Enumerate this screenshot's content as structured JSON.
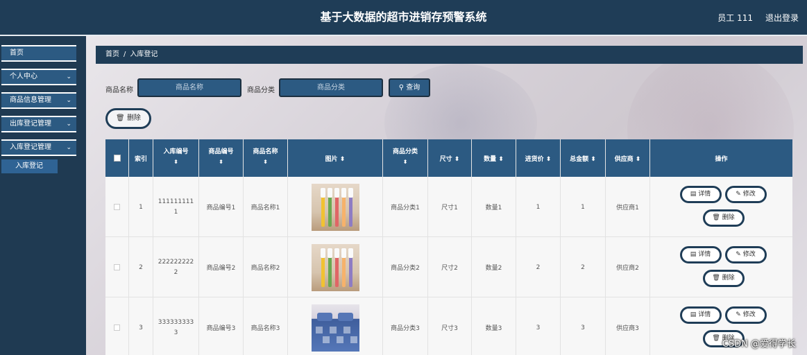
{
  "header": {
    "title": "基于大数据的超市进销存预警系统",
    "user": "员工 111",
    "logout": "退出登录"
  },
  "sidebar": {
    "items": [
      {
        "label": "首页",
        "chevron": ""
      },
      {
        "label": "个人中心",
        "chevron": "⌄"
      },
      {
        "label": "商品信息管理",
        "chevron": "⌄"
      },
      {
        "label": "出库登记管理",
        "chevron": "⌄"
      },
      {
        "label": "入库登记管理",
        "chevron": "⌄"
      }
    ],
    "sub_item": "入库登记"
  },
  "breadcrumb": {
    "home": "首页",
    "sep": "/",
    "current": "入库登记"
  },
  "search": {
    "name_label": "商品名称",
    "name_placeholder": "商品名称",
    "category_label": "商品分类",
    "category_placeholder": "商品分类",
    "query_button": "查询"
  },
  "delete_button": "删除",
  "table": {
    "headers": [
      "索引",
      "入库编号",
      "商品编号",
      "商品名称",
      "图片",
      "商品分类",
      "尺寸",
      "数量",
      "进货价",
      "总金额",
      "供应商",
      "操作"
    ],
    "sort_icon": "⬍",
    "rows": [
      {
        "index": "1",
        "in_no": "1111111111",
        "goods_no": "商品编号1",
        "goods_name": "商品名称1",
        "image": "toothbrush-image",
        "category": "商品分类1",
        "size": "尺寸1",
        "qty": "数量1",
        "price": "1",
        "total": "1",
        "supplier": "供应商1"
      },
      {
        "index": "2",
        "in_no": "2222222222",
        "goods_no": "商品编号2",
        "goods_name": "商品名称2",
        "image": "toothbrush-image",
        "category": "商品分类2",
        "size": "尺寸2",
        "qty": "数量2",
        "price": "2",
        "total": "2",
        "supplier": "供应商2"
      },
      {
        "index": "3",
        "in_no": "3333333333",
        "goods_no": "商品编号3",
        "goods_name": "商品名称3",
        "image": "bedding-image",
        "category": "商品分类3",
        "size": "尺寸3",
        "qty": "数量3",
        "price": "3",
        "total": "3",
        "supplier": "供应商3"
      }
    ],
    "actions": {
      "detail": "详情",
      "edit": "修改",
      "delete": "删除"
    }
  },
  "watermark": "CSDN @爱得学长"
}
